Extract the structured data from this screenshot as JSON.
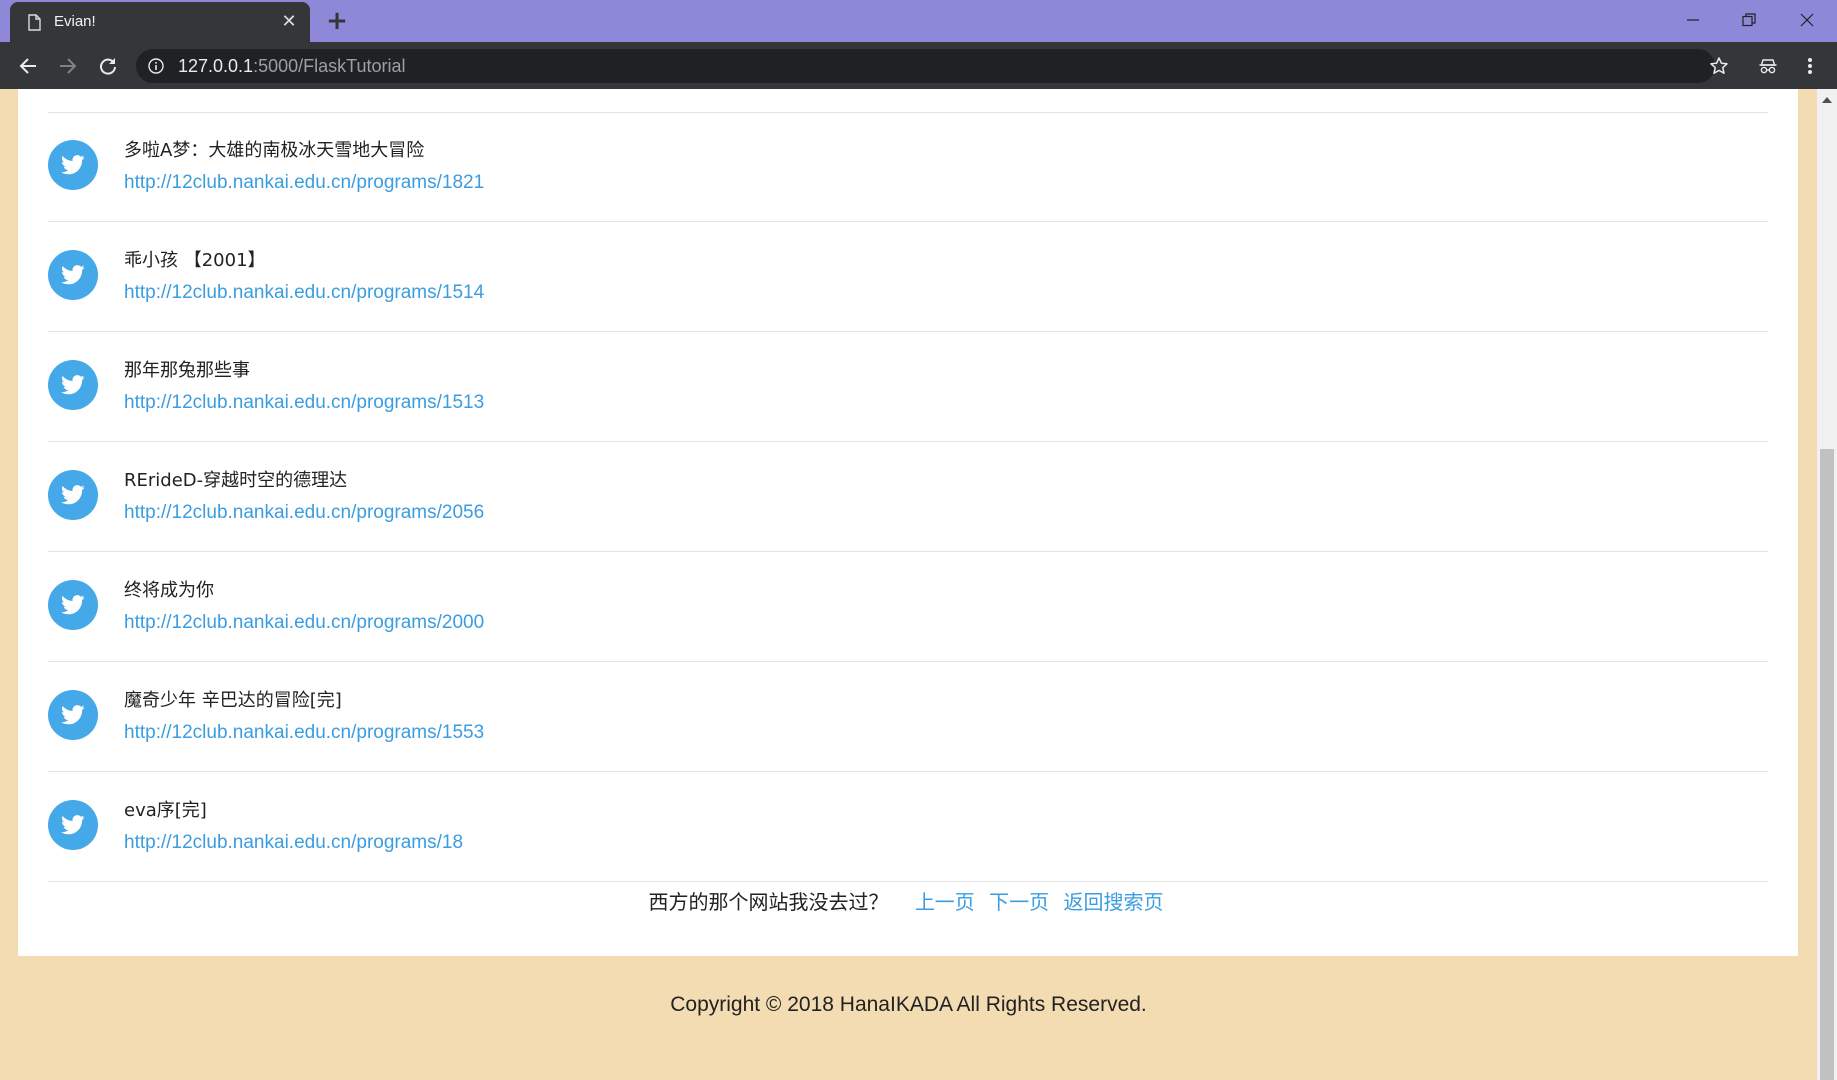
{
  "browser": {
    "tab_title": "Evian!",
    "url_host": "127.0.0.1",
    "url_rest": ":5000/FlaskTutorial",
    "new_tab_symbol": "+",
    "close_symbol": "✕"
  },
  "icons": {
    "tab": "document-icon",
    "avatar": "twitter-bird-icon",
    "back": "arrow-left-icon",
    "forward": "arrow-right-icon",
    "reload": "reload-icon",
    "info": "info-icon",
    "bookmark": "star-icon",
    "incognito": "incognito-icon",
    "menu": "kebab-menu-icon"
  },
  "colors": {
    "page_background": "#f3dcb2",
    "tab_strip": "#8d88d7",
    "link": "#3a9de0",
    "avatar": "#45a8e9"
  },
  "items": [
    {
      "title": "多啦A梦：大雄的南极冰天雪地大冒险",
      "link": "http://12club.nankai.edu.cn/programs/1821"
    },
    {
      "title": "乖小孩 【2001】",
      "link": "http://12club.nankai.edu.cn/programs/1514"
    },
    {
      "title": "那年那兔那些事",
      "link": "http://12club.nankai.edu.cn/programs/1513"
    },
    {
      "title": "RErideD-穿越时空的德理达",
      "link": "http://12club.nankai.edu.cn/programs/2056"
    },
    {
      "title": "终将成为你",
      "link": "http://12club.nankai.edu.cn/programs/2000"
    },
    {
      "title": "魔奇少年 辛巴达的冒险[完]",
      "link": "http://12club.nankai.edu.cn/programs/1553"
    },
    {
      "title": "eva序[完]",
      "link": "http://12club.nankai.edu.cn/programs/18"
    }
  ],
  "pager": {
    "text": "西方的那个网站我没去过？",
    "prev": "上一页",
    "next": "下一页",
    "back_to_search": "返回搜索页"
  },
  "footer": {
    "copyright": "Copyright © 2018 HanaIKADA All Rights Reserved."
  }
}
